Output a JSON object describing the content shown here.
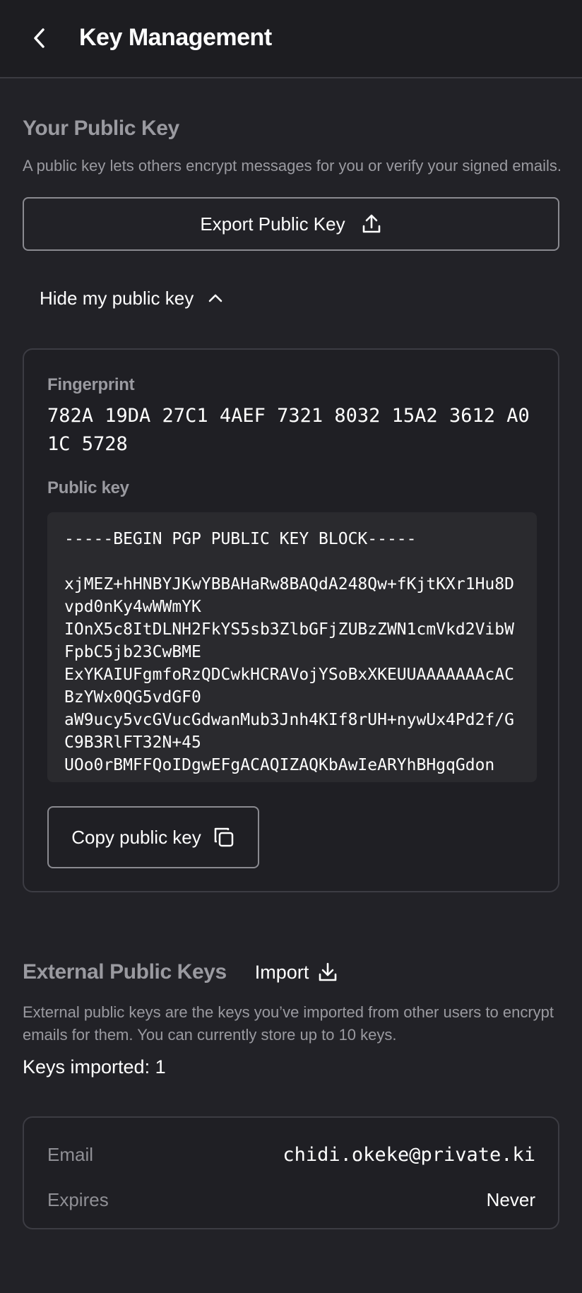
{
  "header": {
    "title": "Key Management"
  },
  "public_key_section": {
    "title": "Your Public Key",
    "description": "A public key lets others encrypt messages for you or verify your signed emails.",
    "export_label": "Export Public Key",
    "toggle_label": "Hide my public key",
    "fingerprint_label": "Fingerprint",
    "fingerprint": "782A 19DA 27C1 4AEF 7321 8032 15A2 3612 A01C 5728",
    "public_key_label": "Public key",
    "public_key_text": "-----BEGIN PGP PUBLIC KEY BLOCK-----\n\nxjMEZ+hHNBYJKwYBBAHaRw8BAQdA248Qw+fKjtKXr1Hu8Dvpd0nKy4wWWmYK\nIOnX5c8ItDLNH2FkYS5sb3ZlbGFjZUBzZWN1cmVkd2VibWFpbC5jb23CwBME\nExYKAIUFgmfoRzQDCwkHCRAVojYSoBxXKEUUAAAAAAAcACBzYWx0QG5vdGF0\naW9ucy5vcGVucGdwanMub3Jnh4KIf8rUH+nywUx4Pd2f/GC9B3RlFT32N+45\nUOo0rBMFFQoIDgwEFgACAQIZAQKbAwIeARYhBHgqGdon",
    "copy_label": "Copy public key"
  },
  "external_keys_section": {
    "title": "External Public Keys",
    "import_label": "Import",
    "description": "External public keys are the keys you’ve imported from other users to encrypt emails for them. You can currently store up to 10 keys.",
    "keys_imported": "Keys imported: 1",
    "entries": [
      {
        "email_label": "Email",
        "email": "chidi.okeke@private.ki",
        "expires_label": "Expires",
        "expires": "Never"
      }
    ]
  },
  "icons": {
    "back": "chevron-left-icon",
    "export": "upload-icon",
    "toggle": "chevron-up-icon",
    "copy": "copy-icon",
    "import": "download-icon"
  }
}
